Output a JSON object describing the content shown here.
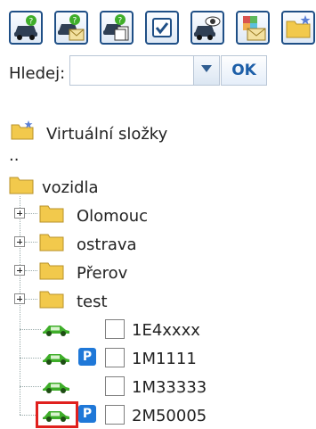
{
  "toolbar": {
    "buttons": [
      {
        "name": "vehicle-search-icon"
      },
      {
        "name": "vehicle-mail-icon"
      },
      {
        "name": "vehicle-report-icon"
      },
      {
        "name": "checkbox-select-icon"
      },
      {
        "name": "vehicle-view-icon"
      },
      {
        "name": "map-mail-icon"
      },
      {
        "name": "new-folder-icon"
      }
    ]
  },
  "search": {
    "label": "Hledej:",
    "value": "",
    "ok_label": "OK"
  },
  "tree": {
    "virtual_folders": "Virtuální složky",
    "parent": "..",
    "root": "vozidla",
    "folders": [
      "Olomouc",
      "ostrava",
      "Přerov",
      "test"
    ],
    "vehicles": [
      {
        "label": "1E4xxxx",
        "parking": false,
        "checked": false
      },
      {
        "label": "1M1111",
        "parking": true,
        "badge": "P",
        "checked": false
      },
      {
        "label": "1M33333",
        "parking": false,
        "checked": false
      },
      {
        "label": "2M50005",
        "parking": true,
        "badge": "P",
        "checked": false,
        "highlighted": true
      }
    ]
  },
  "colors": {
    "accent": "#1f4f86",
    "folder": "#f2c94c",
    "car": "#3fae2a",
    "parking_badge": "#1f78d8",
    "highlight": "#e0201e"
  }
}
